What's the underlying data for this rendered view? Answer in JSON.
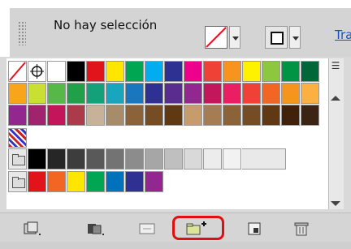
{
  "control_bar": {
    "selection_text": "No hay selección",
    "panel_tab": "Tra"
  },
  "colors": {
    "accent_link": "#1b4fbf",
    "highlight": "#e01010"
  },
  "swatches": {
    "row1": [
      "none",
      "registration",
      "#ffffff",
      "#000000",
      "#e2141b",
      "#ffe600",
      "#00a651",
      "#00aeef",
      "#2e3192",
      "#ec008c",
      "#ef4136",
      "#f7941d",
      "#fff200",
      "#8dc63f",
      "#009444",
      "#006838"
    ],
    "row1b": [
      "#f9a41b",
      "#c9df32",
      "#56b847",
      "#21a04a",
      "#14a079",
      "#18a6bf",
      "#1877bf",
      "#2e3192",
      "#5b2c8f",
      "#92278f",
      "#c2185b",
      "#e91e63",
      "#ef4136",
      "#f36523",
      "#f7941d",
      "#fbb040"
    ],
    "row1c": [
      "#92278f",
      "#a0236d",
      "#c4145a",
      "#ab3a4a",
      "#c7b299",
      "#a68c69",
      "#8c6239",
      "#754c24",
      "#603913",
      "#c69c6d",
      "#a67c52",
      "#8c6239",
      "#754c24",
      "#603813",
      "#42210b",
      "#3c2415"
    ],
    "grays": [
      "#000000",
      "#262626",
      "#3d3d3d",
      "#595959",
      "#737373",
      "#8c8c8c",
      "#a6a6a6",
      "#bfbfbf",
      "#d9d9d9",
      "#ececec",
      "#f2f2f2"
    ],
    "brights": [
      "#e2141b",
      "#f26522",
      "#ffe600",
      "#00a651",
      "#0072bc",
      "#2e3192",
      "#92278f"
    ]
  },
  "toolbar": {
    "icons": [
      "swatch-libraries-icon",
      "swatch-kinds-icon",
      "swatch-options-icon",
      "new-color-group-icon",
      "new-swatch-icon",
      "delete-swatch-icon"
    ]
  }
}
